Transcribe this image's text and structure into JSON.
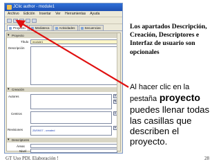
{
  "app": {
    "title": "JClic author - module1",
    "menu": [
      "Archivo",
      "Edición",
      "Insertar",
      "Ver",
      "Herramientas",
      "Ayuda"
    ],
    "tabs": [
      "Proyecto",
      "Mediateca",
      "Actividades",
      "Secuencias"
    ],
    "form": {
      "project_section": "Proyecto",
      "title_label": "Título",
      "title_value": "module1",
      "description_label": "Descripción",
      "creation_section": "Creación",
      "authors_label": "Autores",
      "centers_label": "Centros",
      "revisions_label": "Revisiones",
      "revision_value": "25/09/07 - created",
      "descriptors_section": "Descriptores",
      "subjects_label": "Áreas",
      "level_label": "Nivel",
      "language_label": "Idioma"
    }
  },
  "slide": {
    "intro_text": "Los apartados Descripción, Creación, Descriptores e Interfaz de usuario son opcionales",
    "body_part1": "Al hacer clic en la",
    "body_part2": "pestaña",
    "body_keyword": "proyecto",
    "body_part3": "puedes llenar todas las casillas que describen el proyecto.",
    "footer_left": "GT Uso PDI. Elaboración !",
    "page_number": "28"
  },
  "colors": {
    "arrow": "#e01010",
    "titlebar": "#2f6fd8",
    "window_bg": "#ece9d8"
  }
}
